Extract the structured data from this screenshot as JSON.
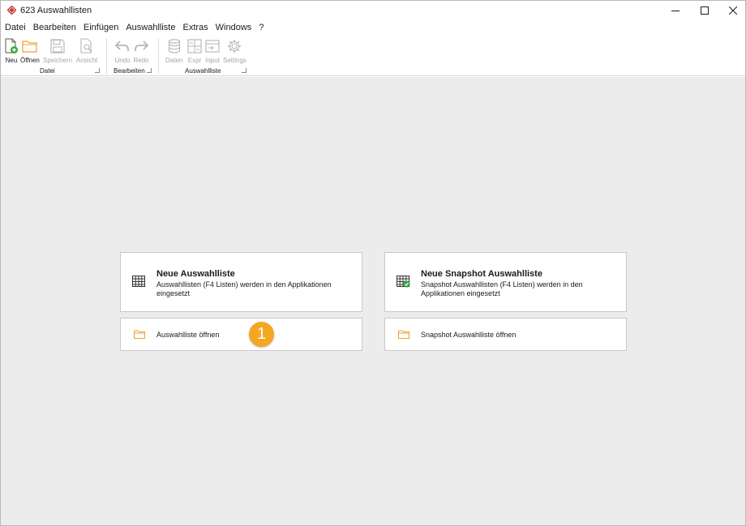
{
  "window": {
    "title": "623 Auswahllisten"
  },
  "menu": [
    "Datei",
    "Bearbeiten",
    "Einfügen",
    "Auswahlliste",
    "Extras",
    "Windows",
    "?"
  ],
  "ribbon": {
    "groups": {
      "datei": "Datei",
      "bearbeiten": "Bearbeiten",
      "auswahlliste": "Auswahlliste"
    },
    "buttons": {
      "neu": "Neu",
      "oeffnen": "Öffnen",
      "speichern": "Speichern",
      "ansicht": "Ansicht",
      "undo": "Undo",
      "redo": "Redo",
      "daten": "Daten",
      "expr": "Expr",
      "input": "Input",
      "settings": "Settings"
    }
  },
  "cards": {
    "neue_auswahlliste": {
      "title": "Neue Auswahlliste",
      "desc": "Auswahllisten (F4 Listen) werden in den Applikationen eingesetzt"
    },
    "neue_snapshot": {
      "title": "Neue Snapshot Auswahlliste",
      "desc": "Snapshot Auswahllisten (F4 Listen) werden in den Applikationen eingesetzt"
    },
    "auswahlliste_oeffnen": {
      "label": "Auswahlliste öffnen"
    },
    "snapshot_oeffnen": {
      "label": "Snapshot Auswahlliste öffnen"
    }
  },
  "badge": {
    "number": "1"
  },
  "colors": {
    "accent": "#f5a623",
    "folder": "#f0a030",
    "new_green": "#2eaa3c",
    "app_icon": "#c0392b"
  }
}
